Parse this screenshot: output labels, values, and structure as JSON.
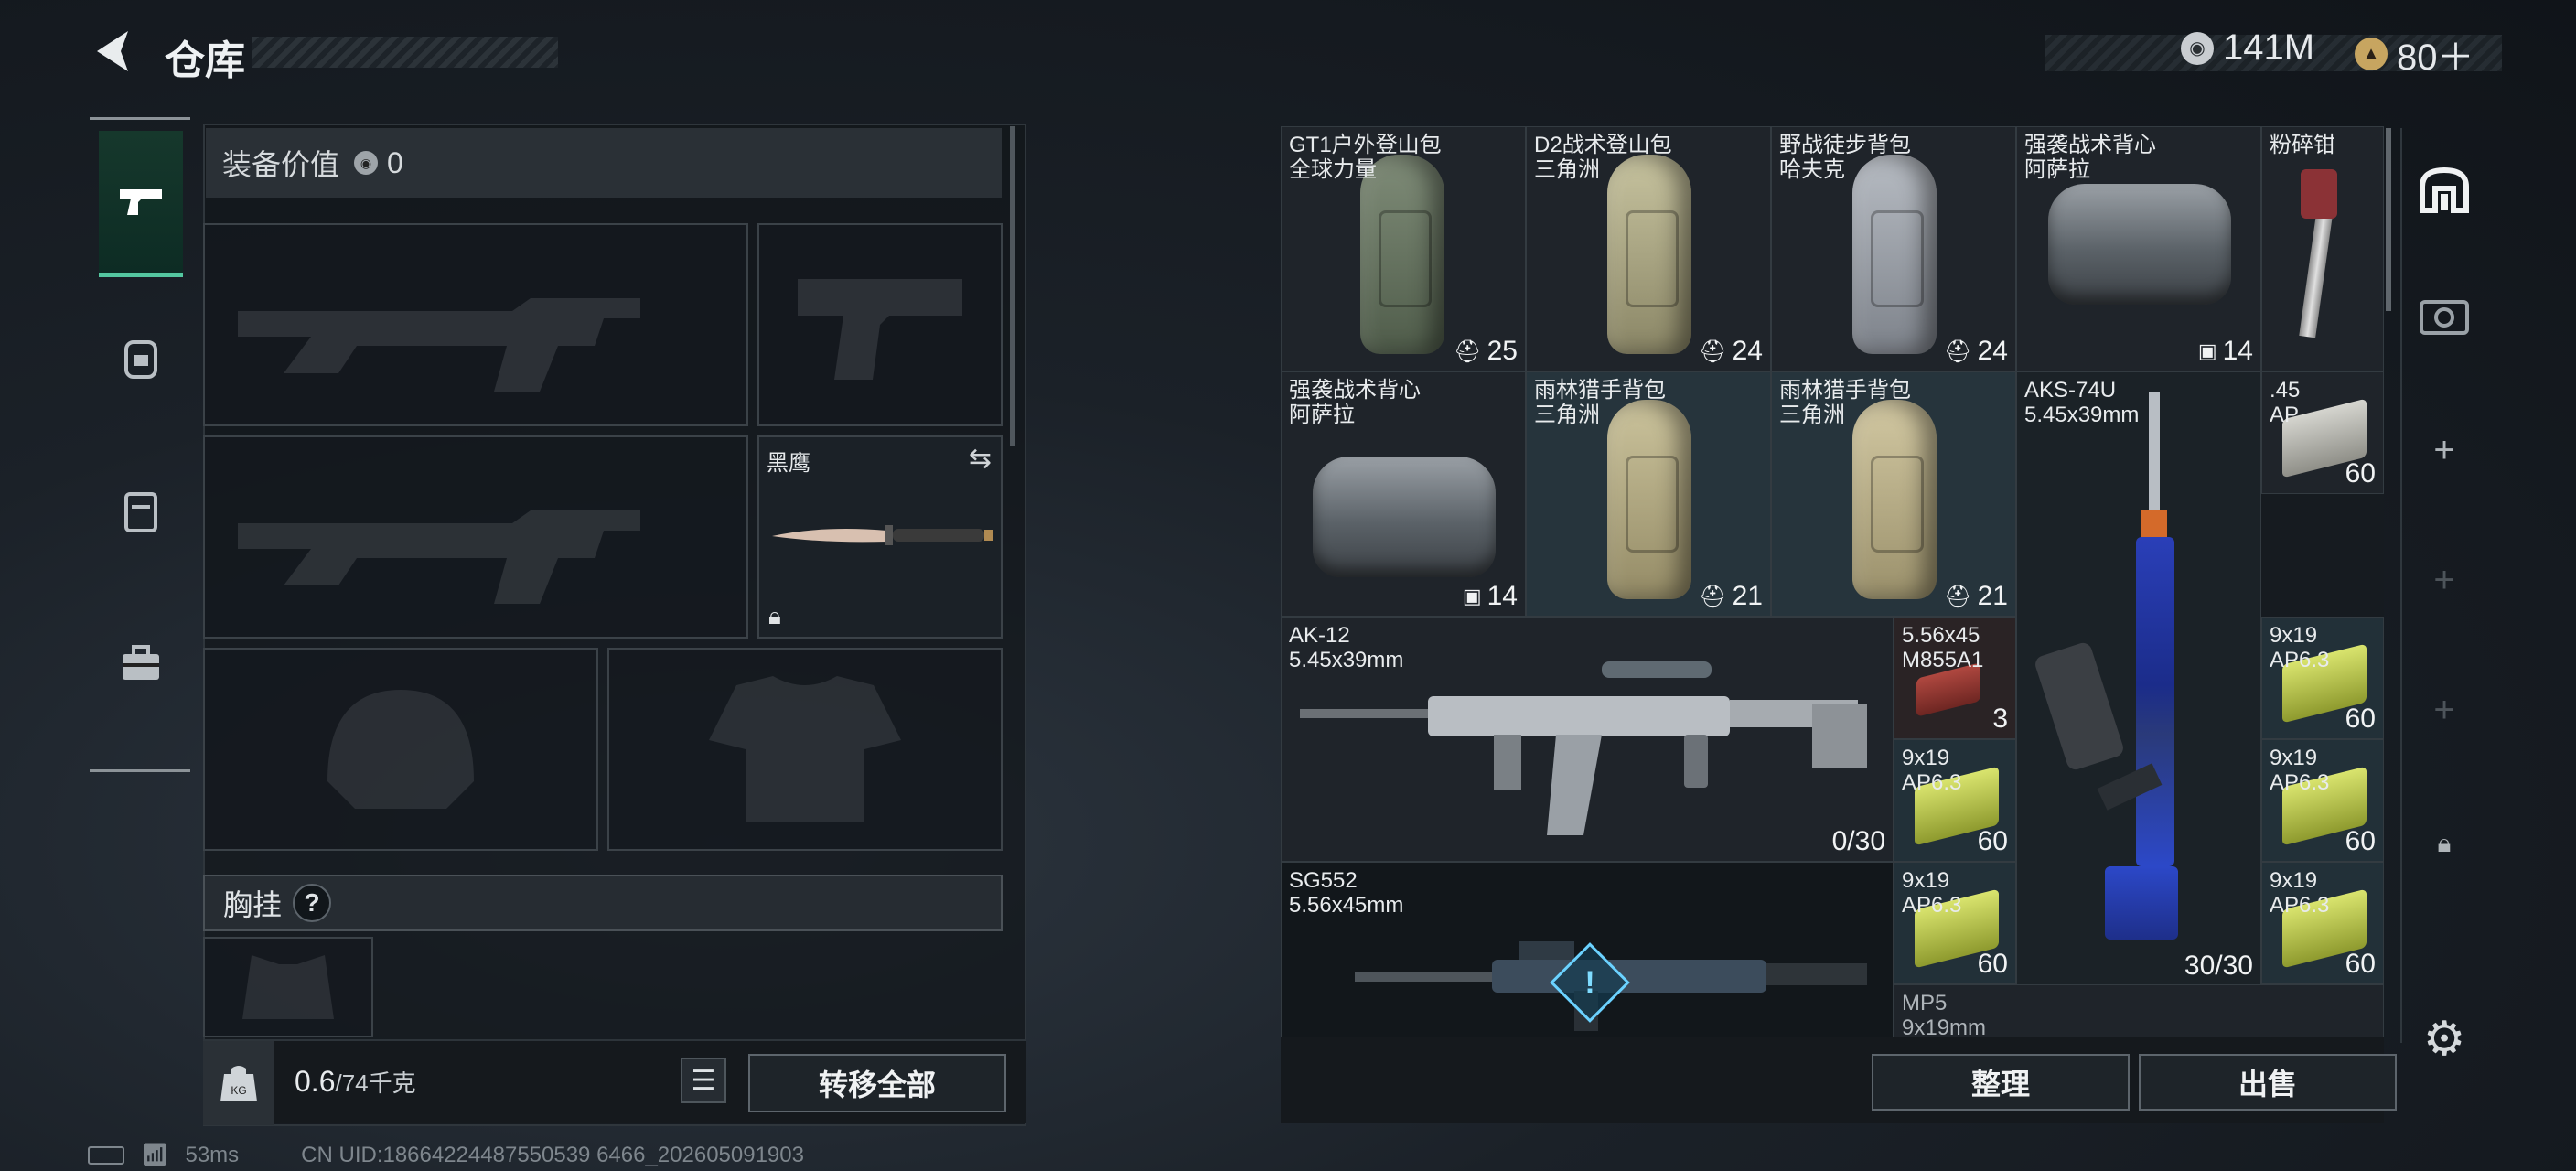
{
  "header": {
    "title": "仓库",
    "back_icon": "back-arrow-icon"
  },
  "currency": [
    {
      "icon": "coin-icon",
      "value": "141M"
    },
    {
      "icon": "ticket-coin-icon",
      "value": "80＋"
    }
  ],
  "sidebar": [
    {
      "icon": "gun-icon",
      "active": true
    },
    {
      "icon": "backpack-icon",
      "active": false
    },
    {
      "icon": "vest-icon",
      "active": false
    },
    {
      "icon": "briefcase-icon",
      "active": false
    }
  ],
  "loadout": {
    "value_label": "装备价值",
    "value": "0",
    "knife_label": "黑鹰",
    "chest_label": "胸挂",
    "help": "?",
    "weight_current": "0.6",
    "weight_max": "/74千克",
    "transfer_all": "转移全部"
  },
  "stash": {
    "items": [
      {
        "name1": "GT1户外登山包",
        "name2": "全球力量",
        "count": "25",
        "badge": "backpack"
      },
      {
        "name1": "D2战术登山包",
        "name2": "三角洲",
        "count": "24",
        "badge": "backpack"
      },
      {
        "name1": "野战徒步背包",
        "name2": "哈夫克",
        "count": "24",
        "badge": "backpack"
      },
      {
        "name1": "强袭战术背心",
        "name2": "阿萨拉",
        "count": "14",
        "badge": "vest"
      },
      {
        "name1": "粉碎钳",
        "name2": ""
      },
      {
        "name1": "强袭战术背心",
        "name2": "阿萨拉",
        "count": "14",
        "badge": "vest"
      },
      {
        "name1": "雨林猎手背包",
        "name2": "三角洲",
        "count": "21",
        "badge": "backpack"
      },
      {
        "name1": "雨林猎手背包",
        "name2": "三角洲",
        "count": "21",
        "badge": "backpack"
      },
      {
        "name1": "AKS-74U",
        "name2": "5.45x39mm",
        "count": "30/30"
      },
      {
        "name1": ".45",
        "name2": "AP",
        "count": "60"
      },
      {
        "name1": "AK-12",
        "name2": "5.45x39mm",
        "count": "0/30"
      },
      {
        "name1": "5.56x45",
        "name2": "M855A1",
        "count": "3"
      },
      {
        "name1": "9x19",
        "name2": "AP6.3",
        "count": "60"
      },
      {
        "name1": "9x19",
        "name2": "AP6.3",
        "count": "60"
      },
      {
        "name1": "9x19",
        "name2": "AP6.3",
        "count": "60"
      },
      {
        "name1": "SG552",
        "name2": "5.56x45mm"
      },
      {
        "name1": "9x19",
        "name2": "AP6.3",
        "count": "60"
      },
      {
        "name1": "9x19",
        "name2": "AP6.3",
        "count": "60"
      },
      {
        "name1": "MP5",
        "name2": "9x19mm"
      }
    ],
    "sort_button": "整理",
    "sell_button": "出售"
  },
  "right_toolbar": [
    "loadout-icon",
    "camera-icon",
    "plus-icon",
    "plus-icon",
    "plus-icon",
    "lock-icon",
    "settings-icon"
  ],
  "status": {
    "ping": "53ms",
    "uid": "CN UID:18664224487550539 6466_202605091903"
  }
}
